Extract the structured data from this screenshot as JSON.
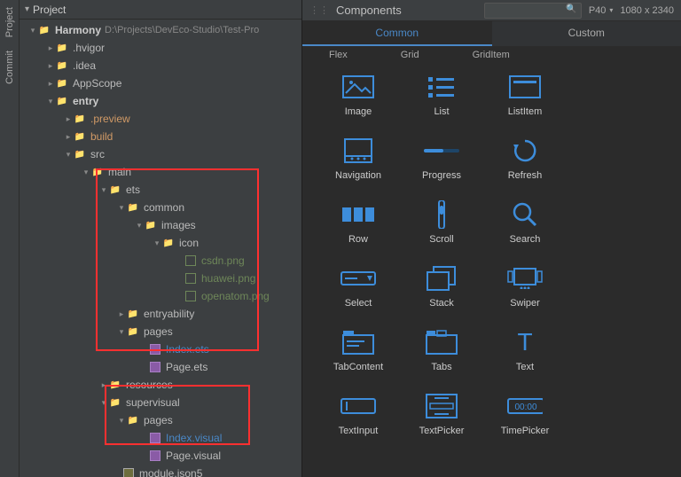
{
  "sidebar": {
    "tab_project": "Project",
    "tab_commit": "Commit"
  },
  "tree_header": {
    "title": "Project"
  },
  "root": {
    "name": "Harmony",
    "path": "D:\\Projects\\DevEco-Studio\\Test-Pro"
  },
  "tree": {
    "hvigor": ".hvigor",
    "idea": ".idea",
    "appscope": "AppScope",
    "entry": "entry",
    "preview": ".preview",
    "build": "build",
    "src": "src",
    "main": "main",
    "ets": "ets",
    "common": "common",
    "images": "images",
    "icon": "icon",
    "csdn": "csdn.png",
    "huawei": "huawei.png",
    "openatom": "openatom.png",
    "entryability": "entryability",
    "pages": "pages",
    "indexets": "Index.ets",
    "pageets": "Page.ets",
    "resources": "resources",
    "supervisual": "supervisual",
    "pages2": "pages",
    "indexvis": "Index.visual",
    "pagevis": "Page.visual",
    "module": "module.json5"
  },
  "panel": {
    "title": "Components",
    "device": "P40",
    "resolution": "1080 x 2340",
    "tabs": {
      "common": "Common",
      "custom": "Custom"
    },
    "subtabs": [
      "Flex",
      "Grid",
      "GridItem"
    ]
  },
  "components": [
    [
      "Image",
      "List",
      "ListItem"
    ],
    [
      "Navigation",
      "Progress",
      "Refresh"
    ],
    [
      "Row",
      "Scroll",
      "Search"
    ],
    [
      "Select",
      "Stack",
      "Swiper"
    ],
    [
      "TabContent",
      "Tabs",
      "Text"
    ],
    [
      "TextInput",
      "TextPicker",
      "TimePicker"
    ]
  ]
}
